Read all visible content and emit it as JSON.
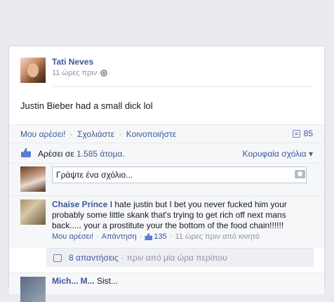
{
  "post": {
    "author": "Tati Neves",
    "time": "11 ώρες πριν",
    "privacy_icon": "globe-icon",
    "text": "Justin Bieber had a small dick lol"
  },
  "actions": {
    "like": "Μου αρέσει!",
    "comment": "Σχολιάστε",
    "share": "Κοινοποιήστε",
    "separator": "·",
    "comment_count": "85"
  },
  "likes": {
    "prefix": "Αρέσει σε",
    "count": "1.585 άτομα.",
    "top_comments": "Κορυφαία σχόλια ▾"
  },
  "comment_input": {
    "placeholder": "Γράψτε ένα σχόλιο..."
  },
  "comment": {
    "author": "Chaise Prince",
    "text": "I hate justin but I bet you never fucked him your probably some little skank that's trying to get rich off next mans back..... your a prostitute your the bottom of the food chain!!!!!!",
    "like": "Μου αρέσει!",
    "reply": "Απάντηση",
    "likes": "135",
    "time": "11 ώρες πριν από κινητό",
    "separator": "·"
  },
  "replies": {
    "count": "8 απαντήσεις",
    "separator": "·",
    "time": "πριν από μία ώρα περίπου"
  },
  "next_comment": {
    "author": "Mich... M...",
    "text": "Sist..."
  }
}
